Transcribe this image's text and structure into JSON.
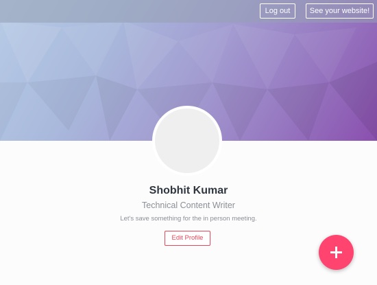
{
  "header": {
    "logout_label": "Log out",
    "website_label": "See your website!"
  },
  "profile": {
    "name": "Shobhit Kumar",
    "title": "Technical Content Writer",
    "bio": "Let's save something for the in person meeting.",
    "edit_label": "Edit Profile"
  },
  "fab": {
    "icon": "plus-icon"
  },
  "colors": {
    "accent": "#e8485b",
    "fab": "#ff4470",
    "cover_start": "#b7cbe6",
    "cover_end": "#8a4fae"
  }
}
